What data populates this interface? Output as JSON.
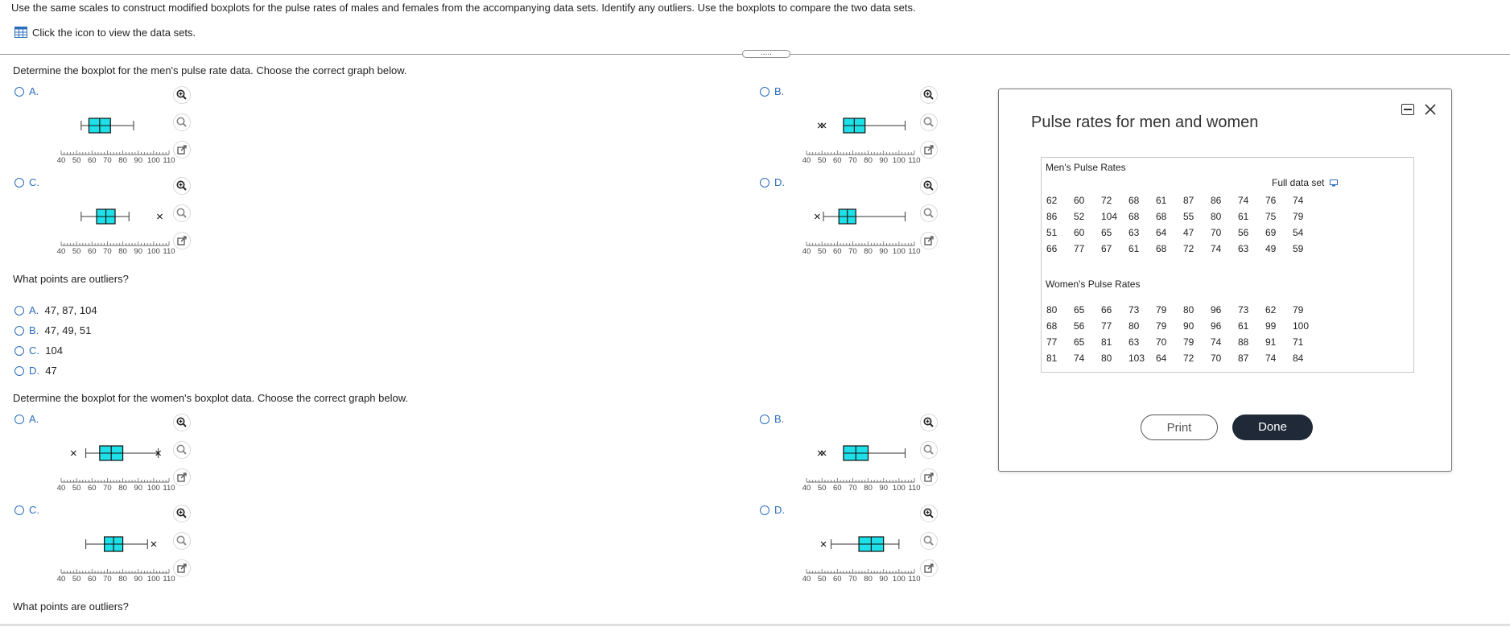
{
  "question": {
    "instruction": "Use the same scales to construct modified boxplots for the pulse rates of males and females from the accompanying data sets. Identify any outliers. Use the boxplots to compare the two data sets.",
    "data_link": "Click the icon to view the data sets.",
    "expand_dots": "....."
  },
  "part1": {
    "prompt": "Determine the boxplot for the men's pulse rate data. Choose the correct graph below.",
    "options": [
      {
        "label": "A.",
        "min": 53,
        "q1": 58,
        "q3": 72,
        "max": 87,
        "outliers": []
      },
      {
        "label": "B.",
        "min": 64,
        "q1": 64,
        "q3": 78,
        "max": 104,
        "outliers": [
          49,
          51
        ]
      },
      {
        "label": "C.",
        "min": 53,
        "q1": 63,
        "q3": 75,
        "max": 84,
        "outliers": [
          104
        ]
      },
      {
        "label": "D.",
        "min": 51,
        "q1": 61,
        "q3": 72,
        "max": 104,
        "outliers": [
          47
        ]
      }
    ]
  },
  "outliers1": {
    "prompt": "What points are outliers?",
    "options": [
      {
        "label": "A.",
        "text": "47, 87, 104"
      },
      {
        "label": "B.",
        "text": "47, 49, 51"
      },
      {
        "label": "C.",
        "text": "104"
      },
      {
        "label": "D.",
        "text": "47"
      }
    ]
  },
  "part2": {
    "prompt": "Determine the boxplot for the women's boxplot data. Choose the correct graph below.",
    "options": [
      {
        "label": "A.",
        "min": 56,
        "q1": 65,
        "q3": 80,
        "max": 103,
        "outliers": [
          48,
          103
        ]
      },
      {
        "label": "B.",
        "min": 64,
        "q1": 64,
        "q3": 80,
        "max": 104,
        "outliers": [
          49,
          51
        ]
      },
      {
        "label": "C.",
        "min": 56,
        "q1": 68,
        "q3": 80,
        "max": 96,
        "outliers": [
          100
        ]
      },
      {
        "label": "D.",
        "min": 56,
        "q1": 74,
        "q3": 90,
        "max": 100,
        "outliers": [
          51
        ]
      }
    ]
  },
  "outliers2": {
    "prompt": "What points are outliers?"
  },
  "axis": {
    "ticks": [
      "40",
      "50",
      "60",
      "70",
      "80",
      "90",
      "100",
      "110"
    ],
    "min": 40,
    "max": 110
  },
  "colors": {
    "box_fill": "#1ee0e8",
    "accent": "#2a6dbd"
  },
  "popup": {
    "title": "Pulse rates for men and women",
    "men_title": "Men's Pulse Rates",
    "full_data_set": "Full data set",
    "men_rows": [
      [
        "62",
        "60",
        "72",
        "68",
        "61",
        "87",
        "86",
        "74",
        "76",
        "74"
      ],
      [
        "86",
        "52",
        "104",
        "68",
        "68",
        "55",
        "80",
        "61",
        "75",
        "79"
      ],
      [
        "51",
        "60",
        "65",
        "63",
        "64",
        "47",
        "70",
        "56",
        "69",
        "54"
      ],
      [
        "66",
        "77",
        "67",
        "61",
        "68",
        "72",
        "74",
        "63",
        "49",
        "59"
      ]
    ],
    "women_title": "Women's Pulse Rates",
    "women_rows": [
      [
        "80",
        "65",
        "66",
        "73",
        "79",
        "80",
        "96",
        "73",
        "62",
        "79"
      ],
      [
        "68",
        "56",
        "77",
        "80",
        "79",
        "90",
        "96",
        "61",
        "99",
        "100"
      ],
      [
        "77",
        "65",
        "81",
        "63",
        "70",
        "79",
        "74",
        "88",
        "91",
        "71"
      ],
      [
        "81",
        "74",
        "80",
        "103",
        "64",
        "72",
        "70",
        "87",
        "74",
        "84"
      ]
    ],
    "print_label": "Print",
    "done_label": "Done"
  }
}
